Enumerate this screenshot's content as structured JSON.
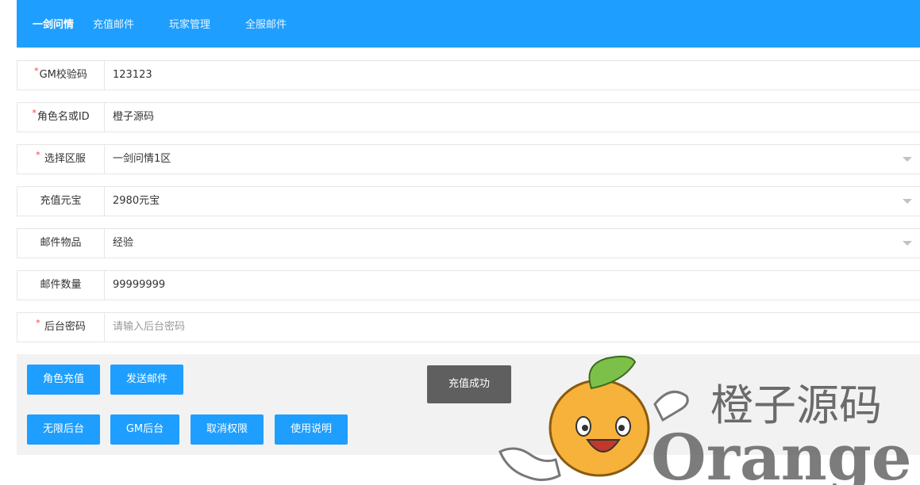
{
  "header": {
    "brand": "一剑问情",
    "nav": [
      "充值邮件",
      "玩家管理",
      "全服邮件"
    ]
  },
  "form": {
    "gm_code": {
      "label": "GM校验码",
      "value": "123123"
    },
    "role": {
      "label": "角色名或ID",
      "value": "橙子源码"
    },
    "server": {
      "label": "选择区服",
      "value": "一剑问情1区"
    },
    "recharge": {
      "label": "充值元宝",
      "value": "2980元宝"
    },
    "item": {
      "label": "邮件物品",
      "value": "经验"
    },
    "quantity": {
      "label": "邮件数量",
      "value": "99999999"
    },
    "password": {
      "label": "后台密码",
      "placeholder": "请输入后台密码"
    },
    "required_mark": "*"
  },
  "buttons": {
    "recharge": "角色充值",
    "send_mail": "发送邮件",
    "unlimited": "无限后台",
    "gm": "GM后台",
    "revoke": "取消权限",
    "help": "使用说明"
  },
  "toast": "充值成功",
  "watermark": {
    "cn_text": "橙子源码",
    "en_text": "Orange"
  },
  "colors": {
    "primary": "#1e9fff",
    "required": "#ff3b3b",
    "toast_bg": "#5f5f5f",
    "panel_bg": "#f2f2f2"
  }
}
